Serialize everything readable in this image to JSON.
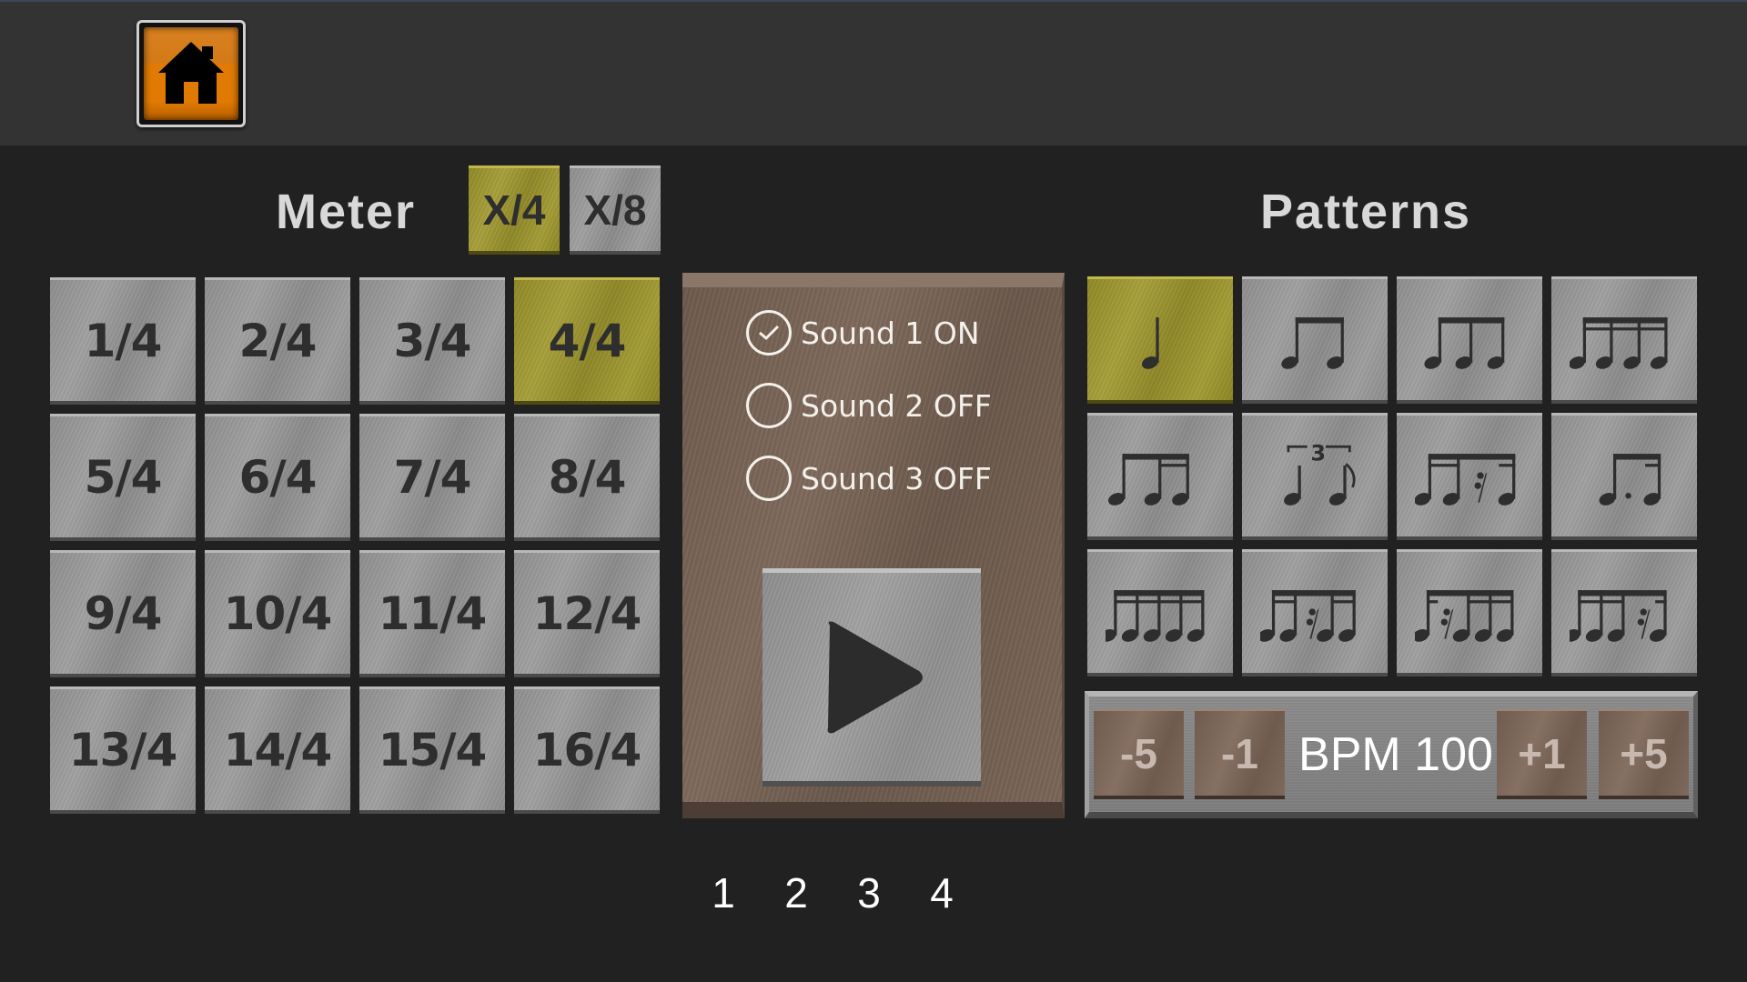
{
  "header": {
    "home_icon": "house-icon"
  },
  "meter": {
    "title": "Meter",
    "modes": [
      {
        "label": "X/4",
        "selected": true
      },
      {
        "label": "X/8",
        "selected": false
      }
    ],
    "options": [
      "1/4",
      "2/4",
      "3/4",
      "4/4",
      "5/4",
      "6/4",
      "7/4",
      "8/4",
      "9/4",
      "10/4",
      "11/4",
      "12/4",
      "13/4",
      "14/4",
      "15/4",
      "16/4"
    ],
    "selected": "4/4"
  },
  "sounds": [
    {
      "label": "Sound 1 ON",
      "checked": true
    },
    {
      "label": "Sound 2 OFF",
      "checked": false
    },
    {
      "label": "Sound 3 OFF",
      "checked": false
    }
  ],
  "play": {
    "icon": "play-icon"
  },
  "patterns": {
    "title": "Patterns",
    "items": [
      {
        "name": "quarter-note",
        "selected": true
      },
      {
        "name": "two-eighths",
        "selected": false
      },
      {
        "name": "eighth-triplet",
        "selected": false
      },
      {
        "name": "four-sixteenths",
        "selected": false
      },
      {
        "name": "eighth-two-sixteenths",
        "selected": false
      },
      {
        "name": "quarter-eighth-triplet",
        "selected": false
      },
      {
        "name": "two-sixteenths-rest-sixteenth",
        "selected": false
      },
      {
        "name": "dotted-eighth-sixteenth",
        "selected": false
      },
      {
        "name": "five-sixteenths-quintuplet",
        "selected": false
      },
      {
        "name": "quintuplet-rest-middle",
        "selected": false
      },
      {
        "name": "quintuplet-rest-second",
        "selected": false
      },
      {
        "name": "quintuplet-rest-fourth",
        "selected": false
      }
    ]
  },
  "bpm": {
    "minus5": "-5",
    "minus1": "-1",
    "display": "BPM 100",
    "value": 100,
    "plus1": "+1",
    "plus5": "+5"
  },
  "beats": [
    "1",
    "2",
    "3",
    "4"
  ],
  "colors": {
    "selected_gold": "#9a9330",
    "tile_grey": "#959595",
    "panel_brown": "#75614f",
    "home_orange": "#e07a02",
    "background": "#212121",
    "header": "#333333"
  }
}
